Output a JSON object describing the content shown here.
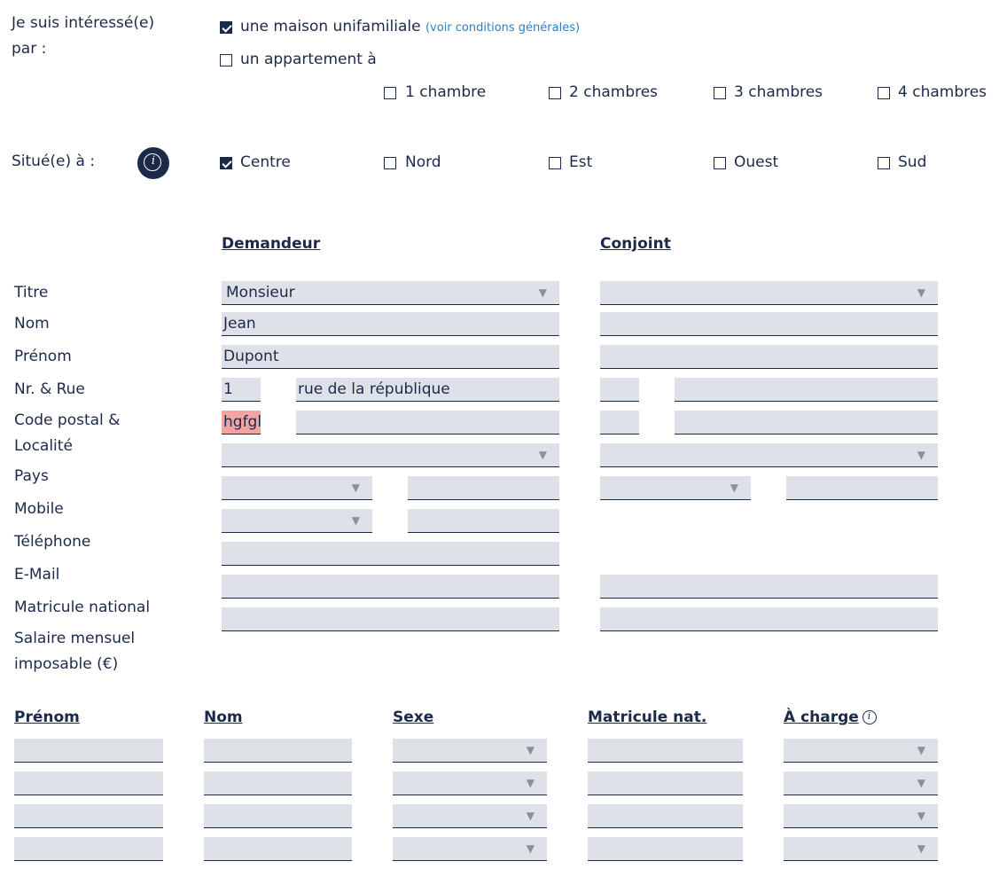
{
  "interest": {
    "label": "Je suis intéressé(e) par :",
    "label_line1": "Je suis intéressé(e)",
    "label_line2": "par :",
    "house_label": "une maison unifamiliale",
    "house_checked": true,
    "conditions_link": "(voir conditions générales)",
    "apartment_label": "un appartement à",
    "apartment_checked": false,
    "rooms": [
      {
        "label": "1 chambre",
        "checked": false
      },
      {
        "label": "2 chambres",
        "checked": false
      },
      {
        "label": "3 chambres",
        "checked": false
      },
      {
        "label": "4 chambres",
        "checked": false
      }
    ]
  },
  "location": {
    "label": "Situé(e) à :",
    "info_icon": "info-icon",
    "options": [
      {
        "label": "Centre",
        "checked": true
      },
      {
        "label": "Nord",
        "checked": false
      },
      {
        "label": "Est",
        "checked": false
      },
      {
        "label": "Ouest",
        "checked": false
      },
      {
        "label": "Sud",
        "checked": false
      }
    ]
  },
  "persons": {
    "applicant_header": "Demandeur",
    "spouse_header": "Conjoint",
    "field_labels": {
      "titre": "Titre",
      "nom": "Nom",
      "prenom": "Prénom",
      "rue": "Nr. & Rue",
      "cp_line1": "Code postal &",
      "cp_line2": "Localité",
      "pays": "Pays",
      "mobile": "Mobile",
      "telephone": "Téléphone",
      "email": "E-Mail",
      "matricule": "Matricule national",
      "salaire_line1": "Salaire mensuel",
      "salaire_line2": "imposable (€)"
    },
    "applicant": {
      "titre": "Monsieur",
      "nom": "Jean",
      "prenom": "Dupont",
      "numero": "1",
      "rue": "rue de la république",
      "code_postal": "hgfgl",
      "localite": "",
      "pays": "",
      "mobile_prefix": "",
      "mobile": "",
      "tel_prefix": "",
      "telephone": "",
      "email": "",
      "matricule": "",
      "salaire": ""
    },
    "spouse": {
      "titre": "",
      "nom": "",
      "prenom": "",
      "numero": "",
      "rue": "",
      "code_postal": "",
      "localite": "",
      "pays": "",
      "mobile_prefix": "",
      "mobile": "",
      "email": "",
      "matricule": "",
      "salaire": ""
    }
  },
  "children": {
    "headers": {
      "prenom": "Prénom",
      "nom": "Nom",
      "sexe": "Sexe",
      "matricule": "Matricule nat.",
      "a_charge": "À charge"
    },
    "info_icon": "info-icon",
    "rows": [
      {
        "prenom": "",
        "nom": "",
        "sexe": "",
        "matricule": "",
        "a_charge": ""
      },
      {
        "prenom": "",
        "nom": "",
        "sexe": "",
        "matricule": "",
        "a_charge": ""
      },
      {
        "prenom": "",
        "nom": "",
        "sexe": "",
        "matricule": "",
        "a_charge": ""
      },
      {
        "prenom": "",
        "nom": "",
        "sexe": "",
        "matricule": "",
        "a_charge": ""
      }
    ]
  },
  "colors": {
    "text": "#1c2a4a",
    "field_bg": "#dfe1e8",
    "error_bg": "#f4a3a3",
    "link": "#2d7fc1"
  }
}
